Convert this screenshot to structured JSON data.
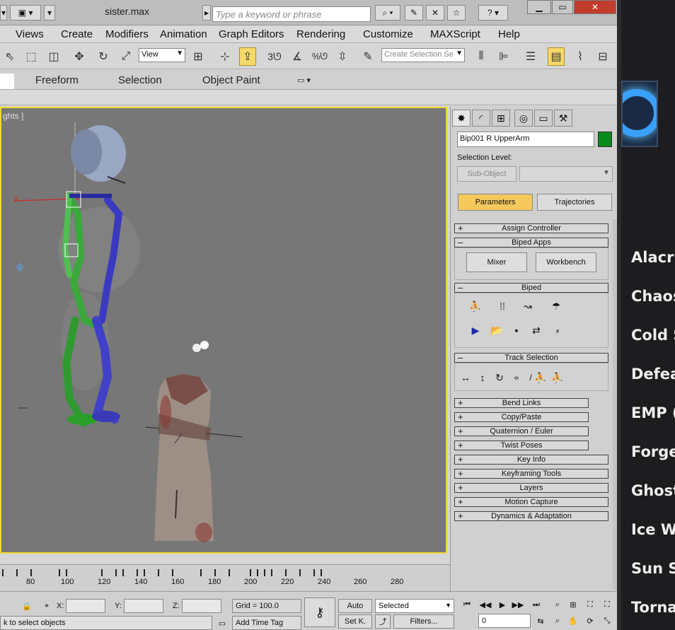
{
  "title": "sister.max",
  "search": {
    "placeholder": "Type a keyword or phrase"
  },
  "menu": [
    "Views",
    "Create",
    "Modifiers",
    "Animation",
    "Graph Editors",
    "Rendering",
    "Customize",
    "MAXScript",
    "Help"
  ],
  "toolbar": {
    "ref_coord": "View",
    "selection_set_placeholder": "Create Selection Se",
    "snap_value": "3"
  },
  "ribbon": {
    "tabs": [
      "Freeform",
      "Selection",
      "Object Paint"
    ]
  },
  "viewport": {
    "label": "ghts ]"
  },
  "command_panel": {
    "object_name": "Bip001 R UpperArm",
    "object_color": "#0a8a1a",
    "selection_level_label": "Selection Level:",
    "sub_object_label": "Sub-Object",
    "parameters_label": "Parameters",
    "trajectories_label": "Trajectories",
    "rollouts": {
      "assign_controller": "Assign Controller",
      "biped_apps": "Biped Apps",
      "mixer": "Mixer",
      "workbench": "Workbench",
      "biped": "Biped",
      "track_selection": "Track Selection",
      "bend_links": "Bend Links",
      "copy_paste": "Copy/Paste",
      "quaternion_euler": "Quaternion / Euler",
      "twist_poses": "Twist Poses",
      "key_info": "Key Info",
      "keyframing_tools": "Keyframing Tools",
      "layers": "Layers",
      "motion_capture": "Motion Capture",
      "dynamics_adaptation": "Dynamics & Adaptation"
    }
  },
  "timeline": {
    "ticks": [
      "80",
      "100",
      "120",
      "140",
      "160",
      "180",
      "200",
      "220",
      "240",
      "260",
      "280"
    ]
  },
  "status": {
    "x_label": "X:",
    "y_label": "Y:",
    "z_label": "Z:",
    "grid": "Grid = 100.0",
    "auto": "Auto",
    "set_key": "Set K.",
    "selected": "Selected",
    "filters": "Filters...",
    "frame": "0",
    "prompt": "k to select objects",
    "add_time_tag": "Add Time Tag"
  },
  "side_app": {
    "items": [
      "Alacrit",
      "Chaos",
      "Cold S",
      "Defea",
      "EMP (",
      "Forged",
      "Ghost",
      "Ice Wa",
      "Sun St",
      "Tornac"
    ]
  }
}
